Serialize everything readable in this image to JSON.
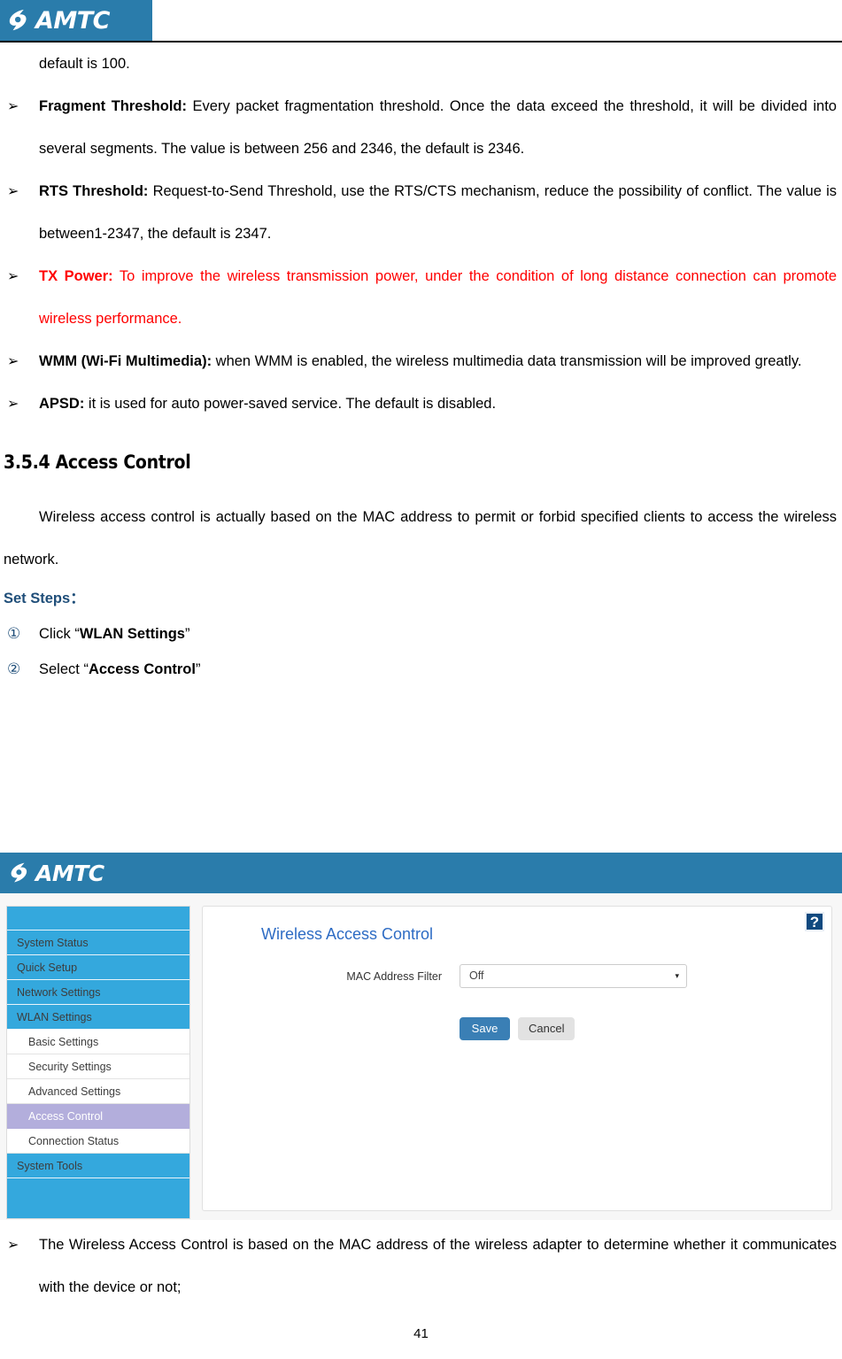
{
  "header": {
    "logo_text": "AMTC",
    "logo_mark_icon": "swoosh-leaf-icon"
  },
  "document": {
    "continued_line": "default is 100.",
    "bullets": [
      {
        "marker": "➢",
        "lead": "Fragment Threshold:",
        "body": " Every packet fragmentation threshold. Once the data exceed the threshold, it will be divided into several segments. The value is between 256 and 2346, the default is 2346.",
        "color": "#000000"
      },
      {
        "marker": "➢",
        "lead": "RTS Threshold:",
        "body": " Request-to-Send Threshold, use the RTS/CTS mechanism, reduce the possibility of conflict. The value is between1-2347, the default is 2347.",
        "color": "#000000"
      },
      {
        "marker": "➢",
        "lead": "TX Power:",
        "body": " To improve the wireless transmission power, under the condition of long distance connection can promote wireless performance.",
        "color": "#ff0000"
      },
      {
        "marker": "➢",
        "lead": "WMM (Wi-Fi Multimedia):",
        "body": " when WMM is enabled, the wireless multimedia data transmission will be improved greatly.",
        "color": "#000000"
      },
      {
        "marker": "➢",
        "lead": "APSD:",
        "body": " it is used for auto power-saved service. The default is disabled.",
        "color": "#000000"
      }
    ],
    "section_title": "3.5.4 Access Control",
    "section_intro": "Wireless access control is actually based on the MAC address to permit or forbid specified clients to access the wireless network.",
    "set_steps_label": "Set Steps：",
    "steps": [
      {
        "number": "①",
        "prefix": "Click “",
        "bold": "WLAN Settings",
        "suffix": "”"
      },
      {
        "number": "②",
        "prefix": "Select “",
        "bold": "Access Control",
        "suffix": "”"
      }
    ],
    "closing_bullet": {
      "marker": "➢",
      "text": "The Wireless Access Control is based on the MAC address of the wireless adapter to determine whether it communicates with the device or not;"
    },
    "page_number": "41"
  },
  "screenshot": {
    "topbar": {
      "logo_text": "AMTC",
      "logo_mark_icon": "swoosh-leaf-icon"
    },
    "sidebar": {
      "items": [
        {
          "label": "System Status",
          "level": "top"
        },
        {
          "label": "Quick Setup",
          "level": "top"
        },
        {
          "label": "Network Settings",
          "level": "top"
        },
        {
          "label": "WLAN Settings",
          "level": "top"
        },
        {
          "label": "Basic Settings",
          "level": "sub"
        },
        {
          "label": "Security Settings",
          "level": "sub"
        },
        {
          "label": "Advanced Settings",
          "level": "sub"
        },
        {
          "label": "Access Control",
          "level": "sub",
          "active": true
        },
        {
          "label": "Connection Status",
          "level": "sub"
        },
        {
          "label": "System Tools",
          "level": "top"
        }
      ]
    },
    "panel": {
      "title": "Wireless Access Control",
      "help_icon": "?",
      "field_label": "MAC Address Filter",
      "field_value": "Off",
      "field_options": [
        "Off"
      ],
      "caret_icon": "▾",
      "save_label": "Save",
      "cancel_label": "Cancel"
    },
    "colors": {
      "brand_blue": "#2a7cab",
      "nav_blue": "#34a8dd",
      "active_purple": "#b3aedc",
      "title_blue": "#2e6cc4",
      "save_blue": "#3a7fb5",
      "help_navy": "#10497f"
    }
  }
}
